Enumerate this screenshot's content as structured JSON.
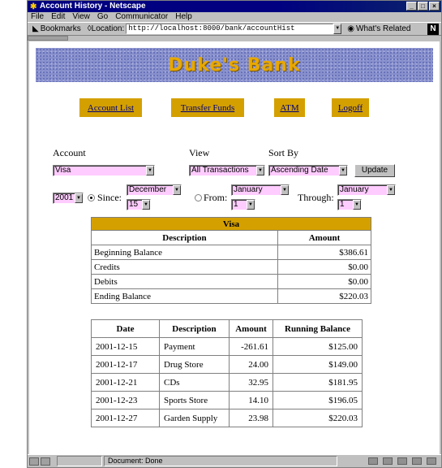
{
  "window": {
    "title": "Account History - Netscape"
  },
  "menu": [
    "File",
    "Edit",
    "View",
    "Go",
    "Communicator",
    "Help"
  ],
  "toolbar": {
    "bookmarks": "Bookmarks",
    "location_label": "Location:",
    "url": "http://localhost:8000/bank/accountHist",
    "related": "What's Related"
  },
  "banner": {
    "title": "Duke's Bank"
  },
  "nav": [
    "Account List",
    "Transfer Funds",
    "ATM",
    "Logoff"
  ],
  "form": {
    "account_label": "Account",
    "account_value": "Visa",
    "view_label": "View",
    "view_value": "All Transactions",
    "sort_label": "Sort By",
    "sort_value": "Ascending Date",
    "update_label": "Update",
    "year_value": "2001",
    "since_label": "Since:",
    "since_month": "December",
    "since_day": "15",
    "from_label": "From:",
    "from_month": "January",
    "from_day": "1",
    "through_label": "Through:",
    "through_month": "January",
    "through_day": "1"
  },
  "summary": {
    "caption": "Visa",
    "headers": [
      "Description",
      "Amount"
    ],
    "rows": [
      [
        "Beginning Balance",
        "$386.61"
      ],
      [
        "Credits",
        "$0.00"
      ],
      [
        "Debits",
        "$0.00"
      ],
      [
        "Ending Balance",
        "$220.03"
      ]
    ]
  },
  "transactions": {
    "headers": [
      "Date",
      "Description",
      "Amount",
      "Running Balance"
    ],
    "rows": [
      [
        "2001-12-15",
        "Payment",
        "-261.61",
        "$125.00"
      ],
      [
        "2001-12-17",
        "Drug Store",
        "24.00",
        "$149.00"
      ],
      [
        "2001-12-21",
        "CDs",
        "32.95",
        "$181.95"
      ],
      [
        "2001-12-23",
        "Sports Store",
        "14.10",
        "$196.05"
      ],
      [
        "2001-12-27",
        "Garden Supply",
        "23.98",
        "$220.03"
      ]
    ]
  },
  "status": {
    "text": "Document: Done"
  }
}
